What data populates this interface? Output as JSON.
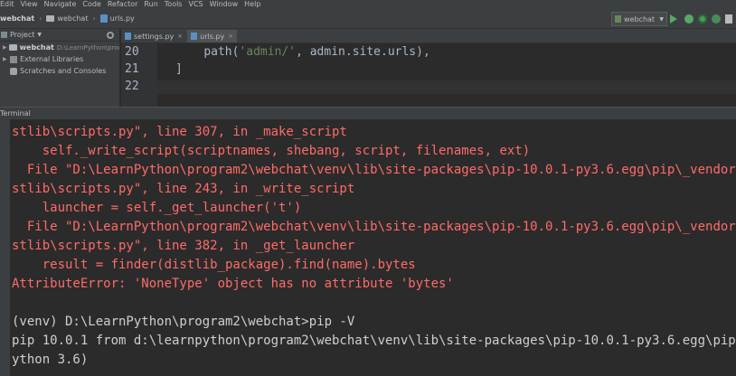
{
  "menu": [
    "Edit",
    "View",
    "Navigate",
    "Code",
    "Refactor",
    "Run",
    "Tools",
    "VCS",
    "Window",
    "Help"
  ],
  "breadcrumb": [
    "webchat",
    "webchat",
    "urls.py"
  ],
  "run_config": "webchat",
  "sidebar": {
    "title": "Project",
    "items": [
      {
        "label": "webchat",
        "path": "D:\\LearnPython\\progr"
      },
      {
        "label": "External Libraries"
      },
      {
        "label": "Scratches and Consoles"
      }
    ]
  },
  "editor": {
    "tabs": [
      {
        "label": "settings.py"
      },
      {
        "label": "urls.py"
      }
    ],
    "lines": [
      {
        "num": "20",
        "indent": "    ",
        "str": "'admin/'",
        "pre": "path(",
        "post": ", admin.site.urls),"
      },
      {
        "num": "21",
        "text": "]"
      },
      {
        "num": "22",
        "text": ""
      }
    ]
  },
  "terminal": {
    "title": "Terminal",
    "lines": [
      {
        "kind": "err",
        "text": "stlib\\scripts.py\", line 307, in _make_script"
      },
      {
        "kind": "err",
        "text": "    self._write_script(scriptnames, shebang, script, filenames, ext)"
      },
      {
        "kind": "err",
        "text": "  File \"D:\\LearnPython\\program2\\webchat\\venv\\lib\\site-packages\\pip-10.0.1-py3.6.egg\\pip\\_vendor\\"
      },
      {
        "kind": "err",
        "text": "stlib\\scripts.py\", line 243, in _write_script"
      },
      {
        "kind": "err",
        "text": "    launcher = self._get_launcher('t')"
      },
      {
        "kind": "err",
        "text": "  File \"D:\\LearnPython\\program2\\webchat\\venv\\lib\\site-packages\\pip-10.0.1-py3.6.egg\\pip\\_vendor\\"
      },
      {
        "kind": "err",
        "text": "stlib\\scripts.py\", line 382, in _get_launcher"
      },
      {
        "kind": "err",
        "text": "    result = finder(distlib_package).find(name).bytes"
      },
      {
        "kind": "err",
        "text": "AttributeError: 'NoneType' object has no attribute 'bytes'"
      },
      {
        "kind": "out",
        "text": ""
      },
      {
        "kind": "out",
        "text": "(venv) D:\\LearnPython\\program2\\webchat>pip -V"
      },
      {
        "kind": "out",
        "text": "pip 10.0.1 from d:\\learnpython\\program2\\webchat\\venv\\lib\\site-packages\\pip-10.0.1-py3.6.egg\\pip"
      },
      {
        "kind": "out",
        "text": "ython 3.6)"
      }
    ]
  }
}
